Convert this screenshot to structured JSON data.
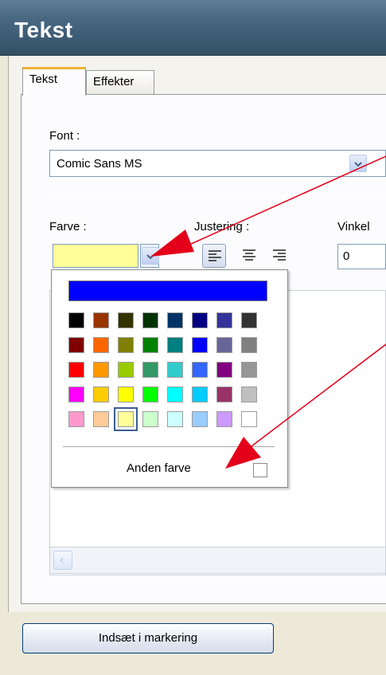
{
  "window": {
    "title": "Tekst"
  },
  "tabs": [
    {
      "label": "Tekst",
      "active": true
    },
    {
      "label": "Effekter",
      "active": false
    }
  ],
  "font": {
    "label": "Font :",
    "value": "Comic Sans MS"
  },
  "color": {
    "label": "Farve :",
    "selected": "#ffff99"
  },
  "alignment": {
    "label": "Justering :",
    "options": [
      "align-left",
      "align-center",
      "align-right"
    ],
    "selected": "align-left"
  },
  "angle": {
    "label": "Vinkel",
    "value": "0"
  },
  "color_picker": {
    "top_color": "#0000ff",
    "rows": [
      [
        "#000000",
        "#993300",
        "#333300",
        "#003300",
        "#003366",
        "#000080",
        "#333399",
        "#333333"
      ],
      [
        "#800000",
        "#ff6600",
        "#808000",
        "#008000",
        "#008080",
        "#0000ff",
        "#666699",
        "#808080"
      ],
      [
        "#ff0000",
        "#ff9900",
        "#99cc00",
        "#339966",
        "#33cccc",
        "#3366ff",
        "#800080",
        "#969696"
      ],
      [
        "#ff00ff",
        "#ffcc00",
        "#ffff00",
        "#00ff00",
        "#00ffff",
        "#00ccff",
        "#993366",
        "#c0c0c0"
      ],
      [
        "#ff99cc",
        "#ffcc99",
        "#ffff99",
        "#ccffcc",
        "#ccffff",
        "#99ccff",
        "#cc99ff",
        "#ffffff"
      ]
    ],
    "selected_cell": {
      "row": 4,
      "col": 2
    },
    "other_color_label": "Anden farve"
  },
  "insert_button": {
    "label": "Indsæt i markering"
  },
  "annotation": {
    "arrow_color": "#e4001b"
  }
}
